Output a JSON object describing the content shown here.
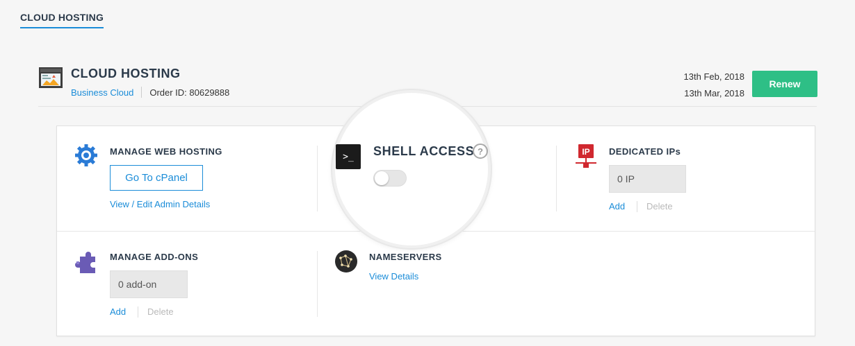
{
  "breadcrumb": {
    "label": "CLOUD HOSTING"
  },
  "product": {
    "title": "CLOUD HOSTING",
    "plan_link": "Business Cloud",
    "order_id": "Order ID: 80629888",
    "icon": "hosting-monitor-icon"
  },
  "dates": {
    "start": "13th Feb, 2018",
    "end": "13th Mar, 2018"
  },
  "renew_label": "Renew",
  "colors": {
    "accent": "#1a8cd8",
    "renew": "#2ebf86",
    "dedicated_ip": "#d0282f",
    "addons": "#6a5bb5"
  },
  "web_hosting": {
    "title": "MANAGE WEB HOSTING",
    "button": "Go To cPanel",
    "link": "View / Edit Admin Details",
    "icon": "gear-icon"
  },
  "shell": {
    "title": "SHELL ACCESS",
    "help": "?",
    "enabled": false,
    "icon": "terminal-icon",
    "terminal_glyph": ">_"
  },
  "dedicated_ips": {
    "title": "DEDICATED IPs",
    "value": "0 IP",
    "add": "Add",
    "delete": "Delete",
    "icon": "ip-network-icon"
  },
  "addons": {
    "title": "MANAGE ADD-ONS",
    "value": "0 add-on",
    "add": "Add",
    "delete": "Delete",
    "icon": "puzzle-icon"
  },
  "nameservers": {
    "title": "NAMESERVERS",
    "link": "View Details",
    "icon": "constellation-icon"
  }
}
